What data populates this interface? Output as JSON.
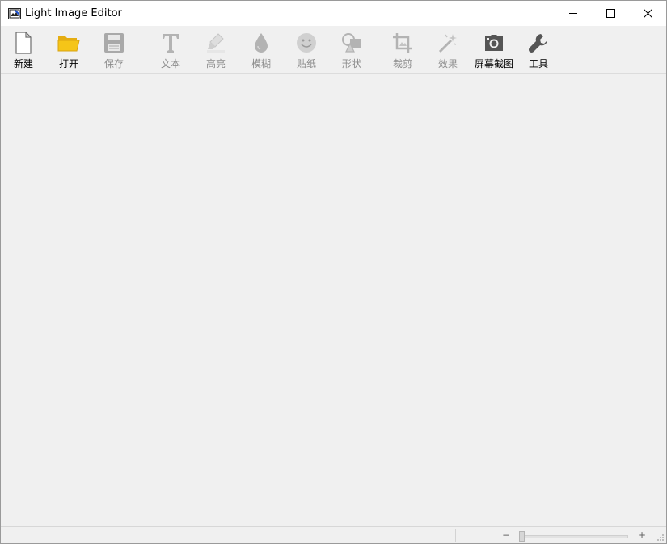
{
  "window": {
    "title": "Light Image Editor",
    "controls": [
      "minimize",
      "maximize",
      "close"
    ]
  },
  "toolbar": {
    "buttons": [
      {
        "id": "new",
        "label": "新建",
        "icon": "new-file-icon",
        "enabled": true
      },
      {
        "id": "open",
        "label": "打开",
        "icon": "open-folder-icon",
        "enabled": true
      },
      {
        "id": "save",
        "label": "保存",
        "icon": "save-disk-icon",
        "enabled": false
      },
      {
        "id": "text",
        "label": "文本",
        "icon": "text-icon",
        "enabled": false
      },
      {
        "id": "highlight",
        "label": "高亮",
        "icon": "highlighter-icon",
        "enabled": false
      },
      {
        "id": "blur",
        "label": "模糊",
        "icon": "blur-drop-icon",
        "enabled": false
      },
      {
        "id": "sticker",
        "label": "贴纸",
        "icon": "smiley-icon",
        "enabled": false
      },
      {
        "id": "shape",
        "label": "形状",
        "icon": "shapes-icon",
        "enabled": false
      },
      {
        "id": "crop",
        "label": "裁剪",
        "icon": "crop-icon",
        "enabled": false
      },
      {
        "id": "effects",
        "label": "效果",
        "icon": "magic-wand-icon",
        "enabled": false
      },
      {
        "id": "screenshot",
        "label": "屏幕截图",
        "icon": "camera-icon",
        "enabled": true
      },
      {
        "id": "tools",
        "label": "工具",
        "icon": "wrench-icon",
        "enabled": true
      }
    ]
  },
  "statusbar": {
    "zoom_minus": "−",
    "zoom_plus": "+"
  },
  "colors": {
    "folder_yellow": "#f5c518",
    "disabled_icon": "#b3b3b3",
    "enabled_icon": "#555555"
  }
}
